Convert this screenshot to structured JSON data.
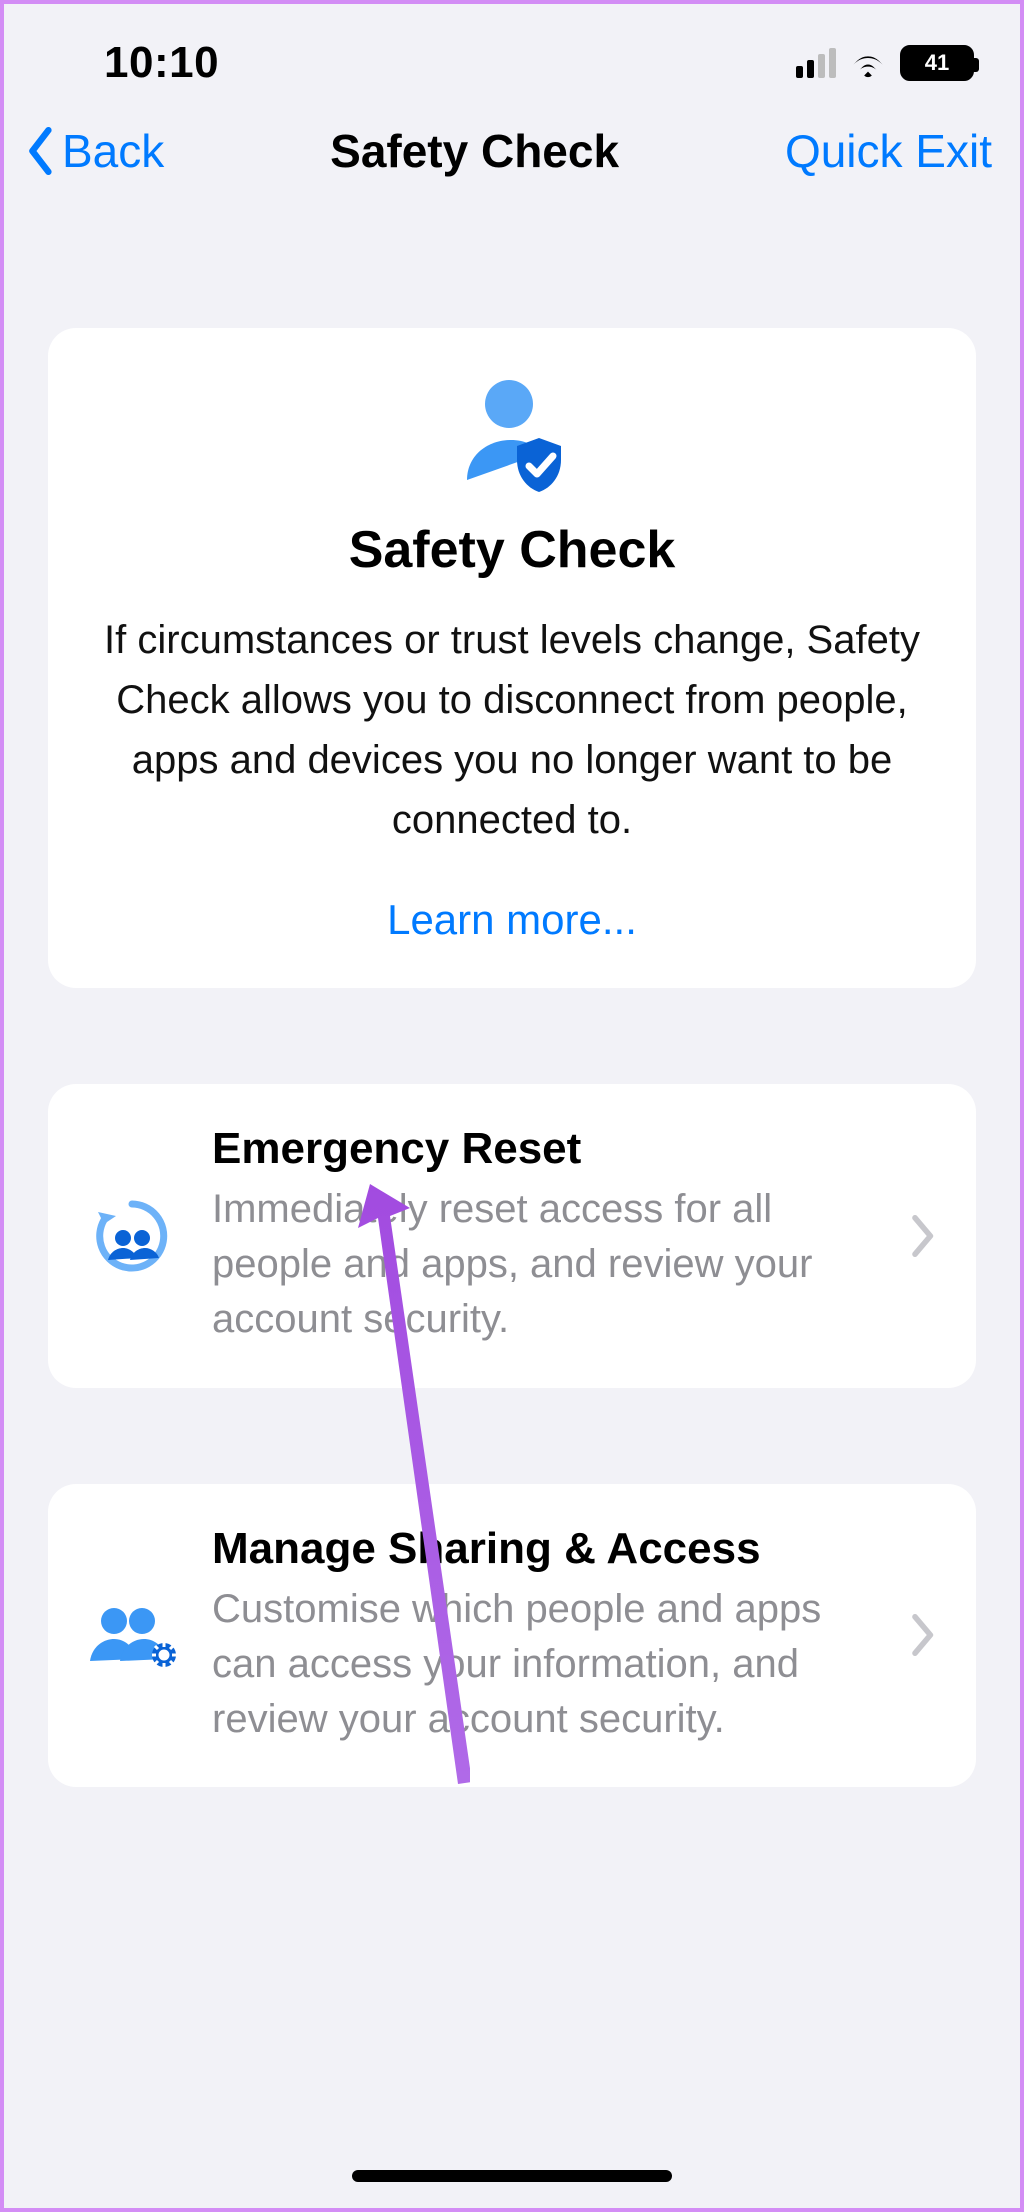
{
  "statusbar": {
    "time": "10:10",
    "battery": "41"
  },
  "navbar": {
    "back": "Back",
    "title": "Safety Check",
    "quick_exit": "Quick Exit"
  },
  "intro": {
    "title": "Safety Check",
    "description": "If circumstances or trust levels change, Safety Check allows you to disconnect from people, apps and devices you no longer want to be connected to.",
    "learn_more": "Learn more..."
  },
  "options": [
    {
      "title": "Emergency Reset",
      "description": "Immediately reset access for all people and apps, and review your account security."
    },
    {
      "title": "Manage Sharing & Access",
      "description": "Customise which people and apps can access your information, and review your account security."
    }
  ]
}
